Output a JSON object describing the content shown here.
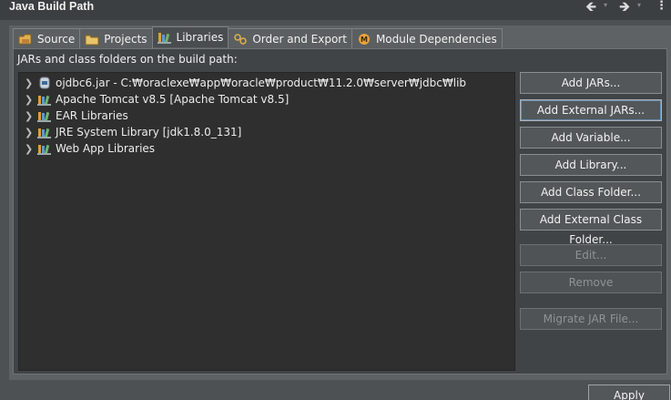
{
  "window": {
    "title": "Java Build Path"
  },
  "tabs": [
    {
      "label": "Source",
      "icon": "source-icon"
    },
    {
      "label": "Projects",
      "icon": "projects-icon"
    },
    {
      "label": "Libraries",
      "icon": "libraries-icon",
      "active": true
    },
    {
      "label": "Order and Export",
      "icon": "order-export-icon"
    },
    {
      "label": "Module Dependencies",
      "icon": "module-icon"
    }
  ],
  "main": {
    "section_label": "JARs and class folders on the build path:",
    "tree_items": [
      {
        "label": "ojdbc6.jar - C:₩oraclexe₩app₩oracle₩product₩11.2.0₩server₩jdbc₩lib",
        "icon": "jar-icon"
      },
      {
        "label": "Apache Tomcat v8.5 [Apache Tomcat v8.5]",
        "icon": "library-icon"
      },
      {
        "label": "EAR Libraries",
        "icon": "library-icon"
      },
      {
        "label": "JRE System Library [jdk1.8.0_131]",
        "icon": "library-icon"
      },
      {
        "label": "Web App Libraries",
        "icon": "library-icon"
      }
    ]
  },
  "buttons": {
    "add_jars": "Add JARs...",
    "add_external_jars": "Add External JARs...",
    "add_variable": "Add Variable...",
    "add_library": "Add Library...",
    "add_class_folder": "Add Class Folder...",
    "add_external_class_folder": "Add External Class Folder...",
    "edit": "Edit...",
    "remove": "Remove",
    "migrate_jar": "Migrate JAR File...",
    "apply": "Apply"
  },
  "colors": {
    "accent": "#6b8fb3",
    "background": "#4d5154",
    "tree_bg": "#2f2f2f"
  }
}
